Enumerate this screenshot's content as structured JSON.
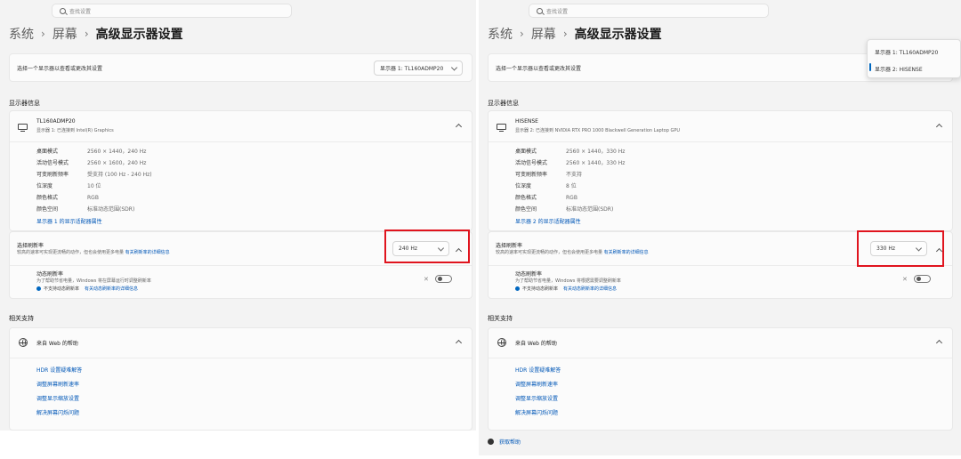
{
  "colors": {
    "highlight": "#e0141e",
    "accent": "#0067c0",
    "link": "#0057b7",
    "background": "#f3f3f3",
    "card": "#fbfbfb"
  },
  "search": {
    "placeholder": "查找设置"
  },
  "breadcrumb": {
    "root": "系统",
    "parent": "屏幕",
    "current": "高级显示器设置",
    "separator": "›"
  },
  "select_display": {
    "label": "选择一个显示器以查看或更改其设置"
  },
  "section_display_info": "显示器信息",
  "section_related": "相关支持",
  "panels": [
    {
      "selected_display": "显示器 1: TL160ADMP20",
      "display_name": "TL160ADMP20",
      "display_sub": "显示器 1: 已连接到 Intel(R) Graphics",
      "rows": [
        {
          "key": "桌面模式",
          "value": "2560 × 1440，240 Hz"
        },
        {
          "key": "活动信号模式",
          "value": "2560 × 1600，240 Hz"
        },
        {
          "key": "可变刷新频率",
          "value": "受支持 (100 Hz - 240 Hz)"
        },
        {
          "key": "位深度",
          "value": "10 位"
        },
        {
          "key": "颜色格式",
          "value": "RGB"
        },
        {
          "key": "颜色空间",
          "value": "标准动态范围(SDR)"
        }
      ],
      "adapter_link": "显示器 1 的显示适配器属性",
      "refresh_title": "选择刷新率",
      "refresh_desc": "较高的速率可实现更流畅的动作，但也会使用更多电量",
      "refresh_desc_link": "有关刷新率的详细信息",
      "refresh_value": "240 Hz",
      "dynamic_title": "动态刷新率",
      "dynamic_desc": "为了帮助节省电量，Windows 将在屏幕运行时调整刷新率",
      "dynamic_note": "不支持动态刷新率",
      "dynamic_note_link": "有关动态刷新率的详细信息"
    },
    {
      "selected_display": "显示器 2: HISENSE",
      "display_name": "HISENSE",
      "display_sub": "显示器 2: 已连接到 NVIDIA RTX PRO 1000 Blackwell Generation Laptop GPU",
      "rows": [
        {
          "key": "桌面模式",
          "value": "2560 × 1440，330 Hz"
        },
        {
          "key": "活动信号模式",
          "value": "2560 × 1440，330 Hz"
        },
        {
          "key": "可变刷新频率",
          "value": "不支持"
        },
        {
          "key": "位深度",
          "value": "8 位"
        },
        {
          "key": "颜色格式",
          "value": "RGB"
        },
        {
          "key": "颜色空间",
          "value": "标准动态范围(SDR)"
        }
      ],
      "adapter_link": "显示器 2 的显示适配器属性",
      "refresh_title": "选择刷新率",
      "refresh_desc": "较高的速率可实现更流畅的动作，但也会使用更多电量",
      "refresh_desc_link": "有关刷新率的详细信息",
      "refresh_value": "330 Hz",
      "dynamic_title": "动态刷新率",
      "dynamic_desc": "为了帮助节省电量，Windows 将根据需要调整刷新率",
      "dynamic_note": "不支持动态刷新率",
      "dynamic_note_link": "有关动态刷新率的详细信息"
    }
  ],
  "help": {
    "title": "来自 Web 的帮助",
    "links": [
      "HDR 设置疑难解答",
      "调整屏幕刷新速率",
      "调整显示缩放设置",
      "解决屏幕闪烁问题"
    ]
  },
  "get_help": "获取帮助",
  "dropdown_popup": {
    "options": [
      "显示器 1: TL160ADMP20",
      "显示器 2: HISENSE"
    ],
    "selected_index": 1
  }
}
